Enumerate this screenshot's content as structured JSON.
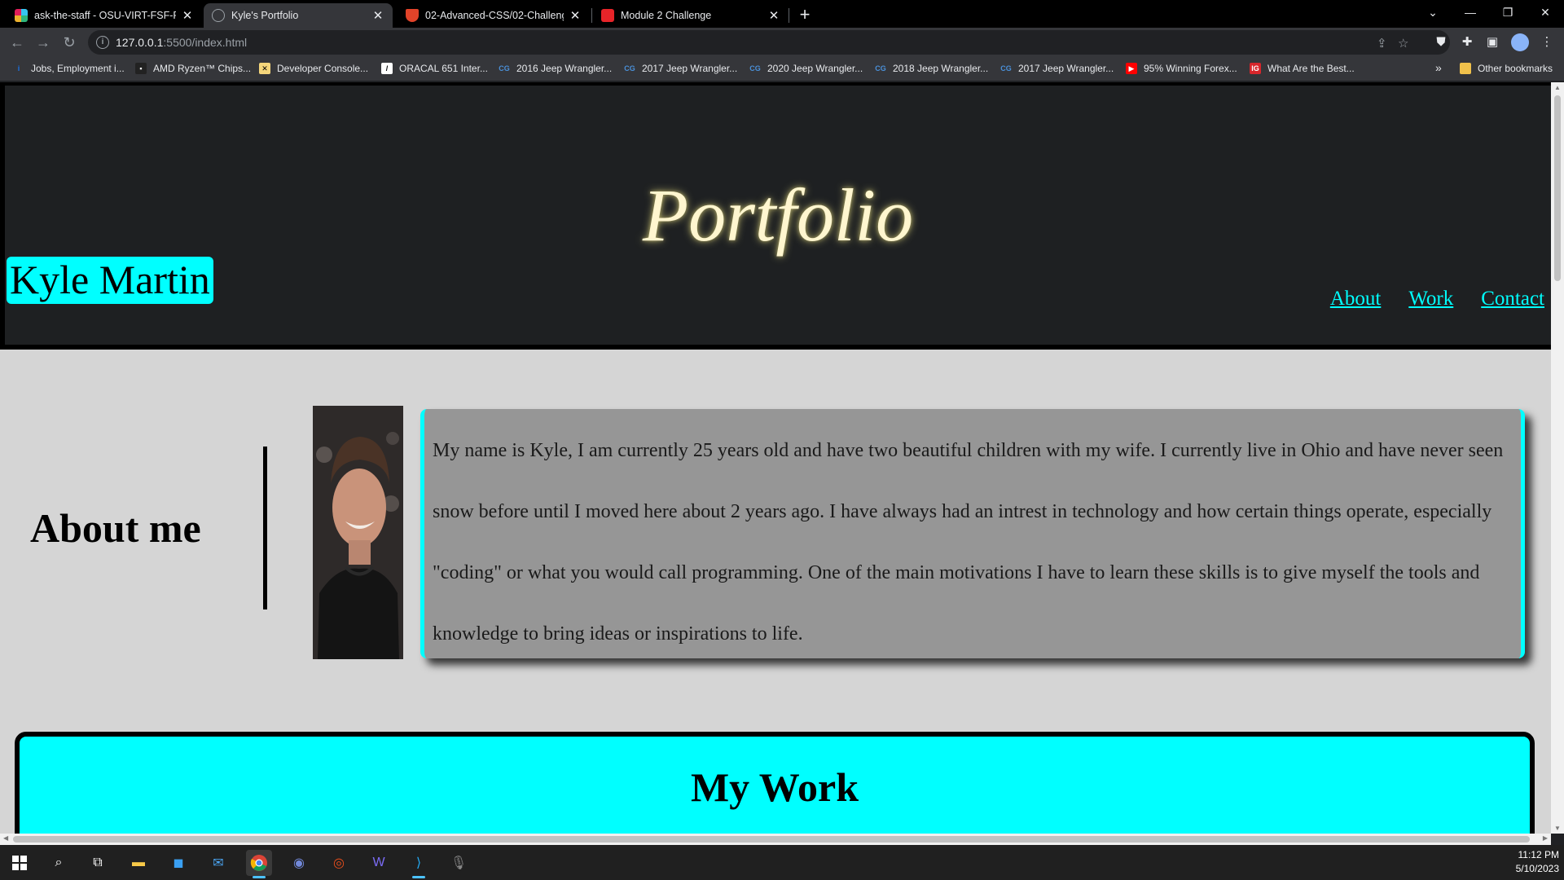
{
  "browser": {
    "tabs": [
      {
        "title": "ask-the-staff - OSU-VIRT-FSF-PT",
        "icon": "slack-icon"
      },
      {
        "title": "Kyle's Portfolio",
        "icon": "globe-icon"
      },
      {
        "title": "02-Advanced-CSS/02-Challenge/",
        "icon": "gitlab-icon"
      },
      {
        "title": "Module 2 Challenge",
        "icon": "canvas-icon"
      }
    ],
    "url_host": "127.0.0.1",
    "url_path": ":5500/index.html",
    "bookmarks": [
      "Jobs, Employment i...",
      "AMD Ryzen™ Chips...",
      "Developer Console...",
      "ORACAL 651 Inter...",
      "2016 Jeep Wrangler...",
      "2017 Jeep Wrangler...",
      "2020 Jeep Wrangler...",
      "2018 Jeep Wrangler...",
      "2017 Jeep Wrangler...",
      "95% Winning Forex...",
      "What Are the Best..."
    ],
    "other_bookmarks": "Other bookmarks",
    "overflow": "»"
  },
  "page": {
    "header": {
      "title": "Portfolio",
      "name": "Kyle Martin",
      "nav": [
        "About",
        "Work",
        "Contact"
      ]
    },
    "about": {
      "heading": "About me",
      "bio": "My name is Kyle, I am currently 25 years old and have two beautiful children with my wife. I currently live in Ohio and have never seen snow before until I moved here about 2 years ago. I have always had an intrest in technology and how certain things operate, especially \"coding\" or what you would call programming. One of the main motivations I have to learn these skills is to give myself the tools and knowledge to bring ideas or inspirations to life."
    },
    "work": {
      "heading": "My Work"
    }
  },
  "taskbar": {
    "time": "11:12 PM",
    "date": "5/10/2023"
  },
  "colors": {
    "accent": "#00ffff",
    "header_bg": "#1e2022",
    "page_bg": "#d5d5d5",
    "bio_bg": "#969696",
    "title_glow": "#fff6cf"
  }
}
